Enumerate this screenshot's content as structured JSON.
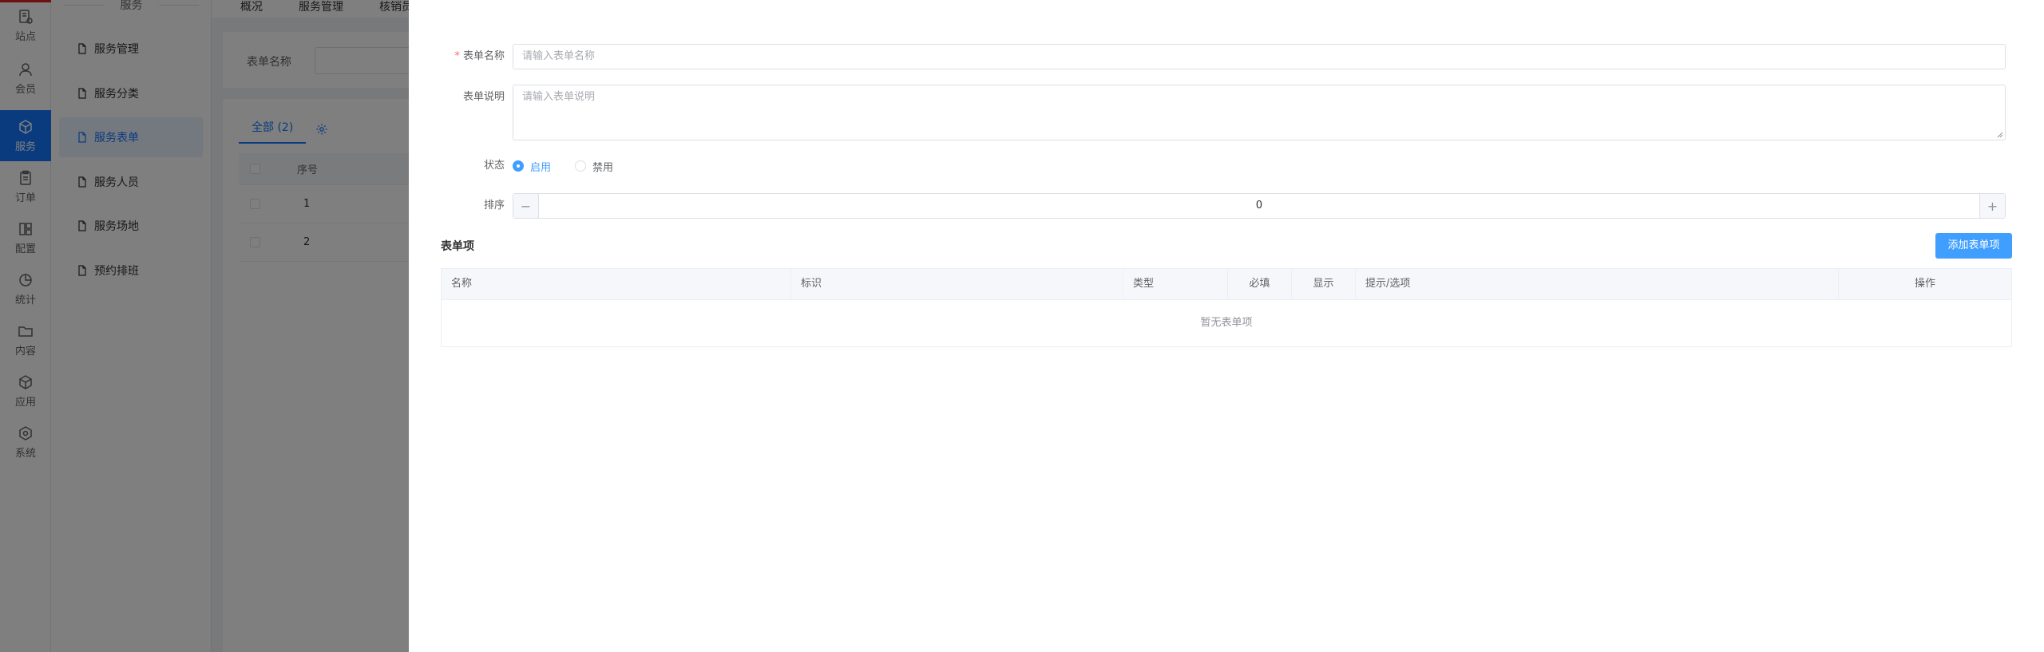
{
  "rail": {
    "items": [
      {
        "label": "站点",
        "icon": "site-icon"
      },
      {
        "label": "会员",
        "icon": "user-icon"
      },
      {
        "label": "服务",
        "icon": "cube-icon",
        "active": true
      },
      {
        "label": "订单",
        "icon": "clipboard-icon"
      },
      {
        "label": "配置",
        "icon": "layout-icon"
      },
      {
        "label": "统计",
        "icon": "pie-chart-icon"
      },
      {
        "label": "内容",
        "icon": "folder-icon"
      },
      {
        "label": "应用",
        "icon": "box-icon"
      },
      {
        "label": "系统",
        "icon": "hexagon-icon"
      }
    ]
  },
  "subnav": {
    "title": "服务",
    "items": [
      {
        "label": "服务管理"
      },
      {
        "label": "服务分类"
      },
      {
        "label": "服务表单",
        "active": true
      },
      {
        "label": "服务人员"
      },
      {
        "label": "服务场地"
      },
      {
        "label": "预约排班"
      }
    ]
  },
  "topbar": {
    "tabs": [
      "概况",
      "服务管理",
      "核销员"
    ]
  },
  "filter": {
    "label": "表单名称"
  },
  "list": {
    "tab_all": "全部 (2)",
    "header_index": "序号",
    "rows": [
      "1",
      "2"
    ]
  },
  "drawer": {
    "name_label": "表单名称",
    "name_required_mark": "*",
    "name_placeholder": "请输入表单名称",
    "desc_label": "表单说明",
    "desc_placeholder": "请输入表单说明",
    "status_label": "状态",
    "status_enable": "启用",
    "status_disable": "禁用",
    "status_selected": "启用",
    "sort_label": "排序",
    "sort_value": "0",
    "sort_minus": "−",
    "sort_plus": "+",
    "items_title": "表单项",
    "add_button": "添加表单项",
    "items_columns": [
      "名称",
      "标识",
      "类型",
      "必填",
      "显示",
      "提示/选项",
      "操作"
    ],
    "items_empty": "暂无表单项"
  },
  "colors": {
    "primary": "#409eff",
    "rail_active": "#1677ff",
    "mask": "rgba(0,0,0,0.5)",
    "required": "#f56c6c"
  }
}
